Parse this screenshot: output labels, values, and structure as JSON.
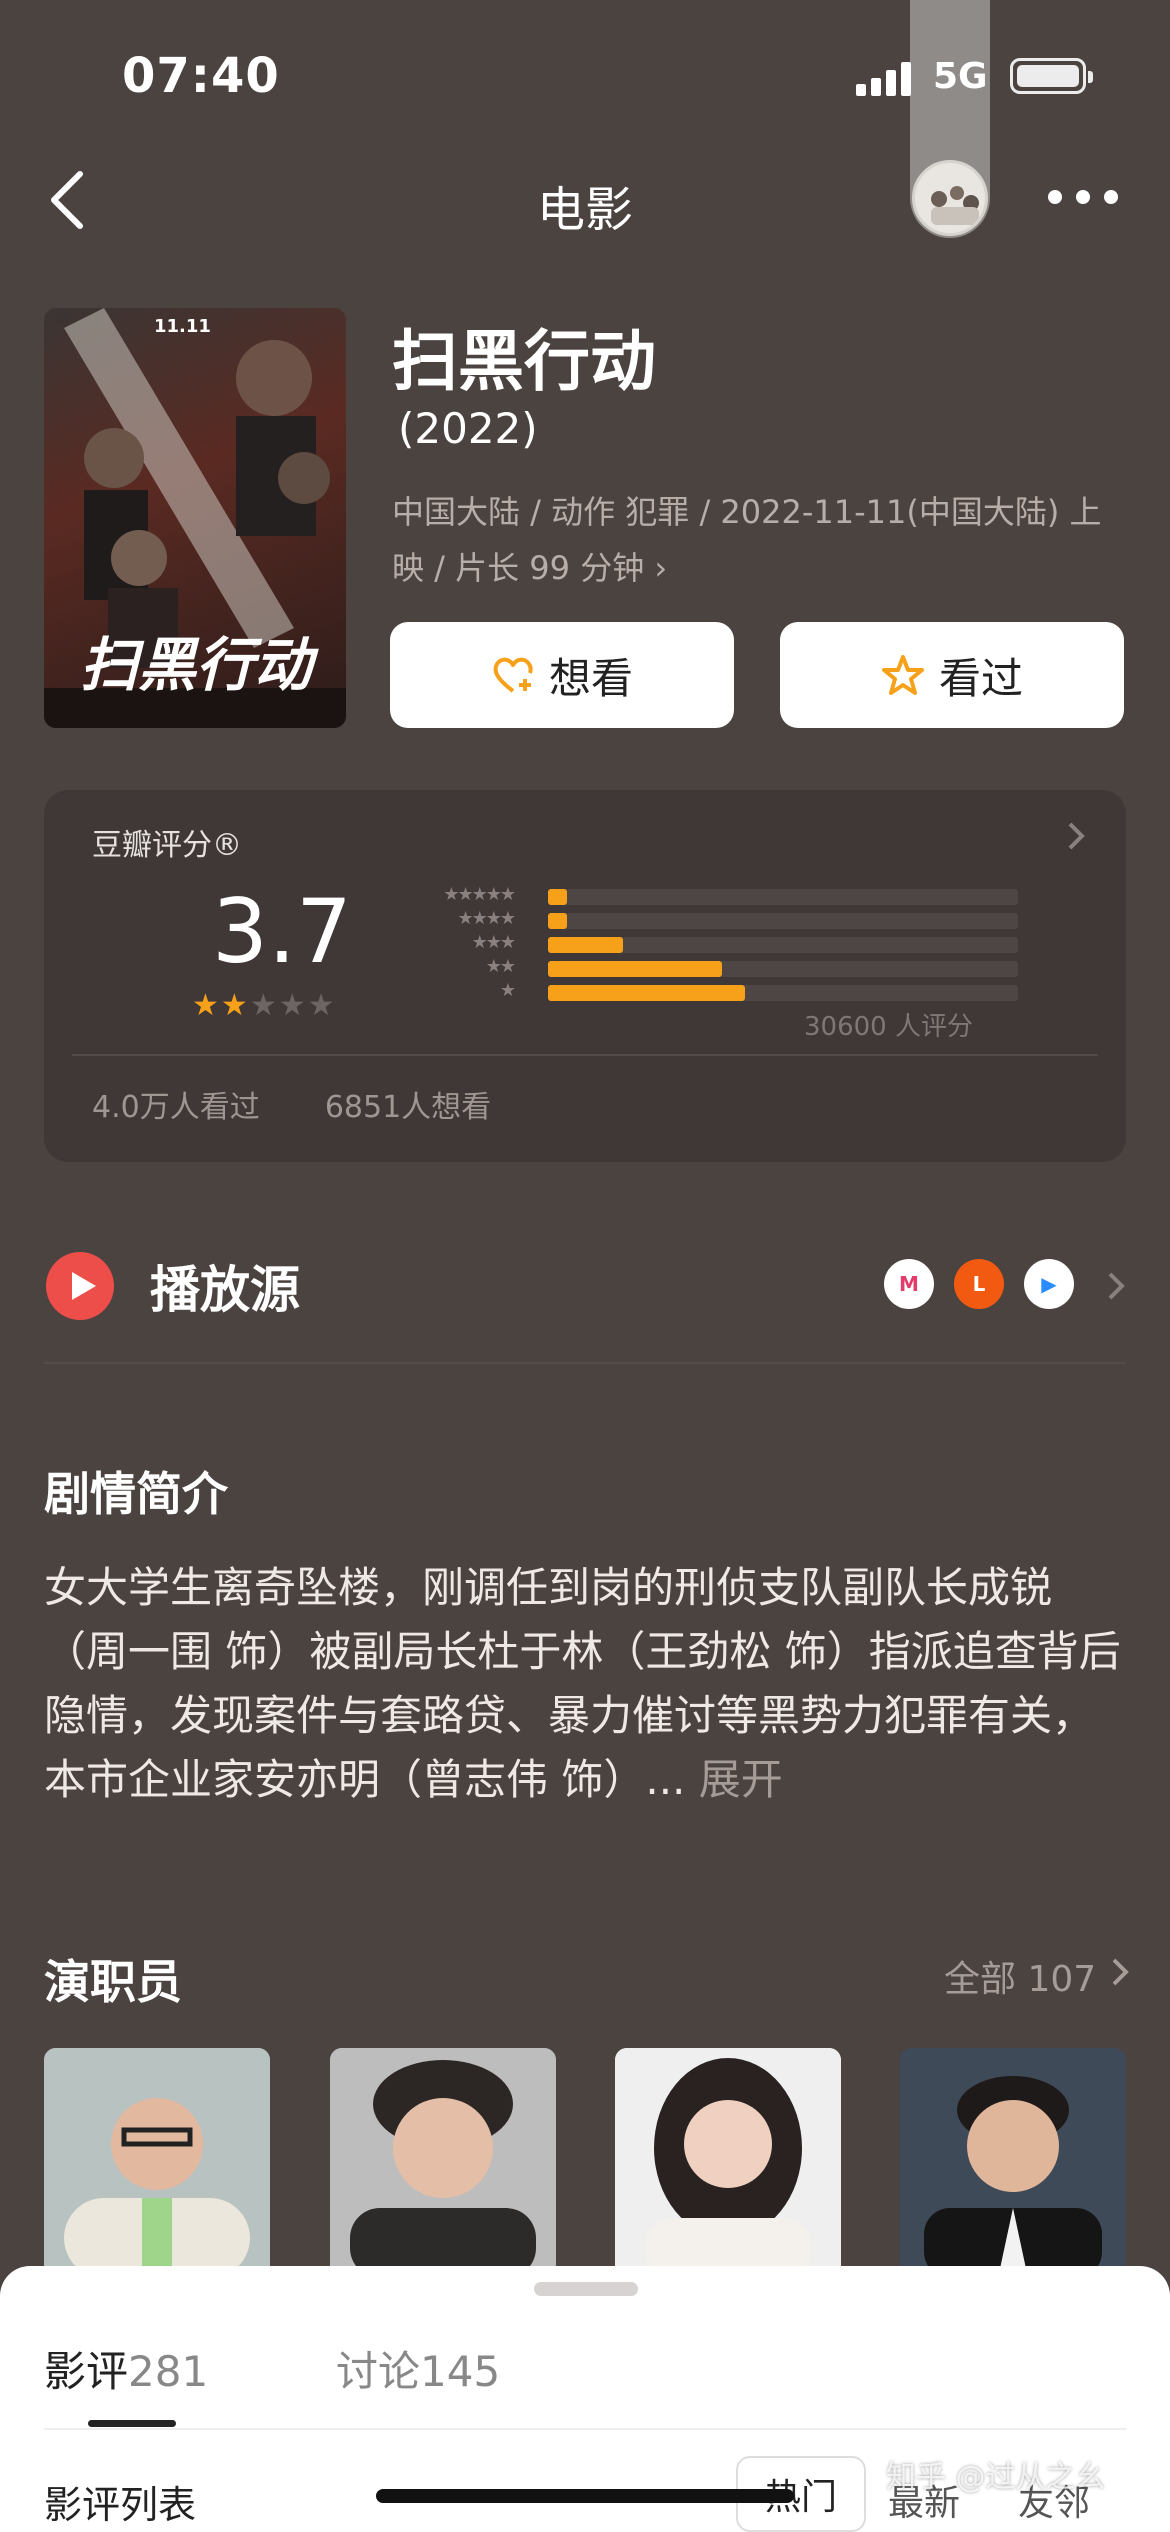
{
  "status_bar": {
    "time": "07:40",
    "network": "5G"
  },
  "nav": {
    "title": "电影"
  },
  "movie": {
    "title": "扫黑行动",
    "year": "(2022)",
    "meta": "中国大陆 / 动作 犯罪 / 2022-11-11(中国大陆) 上映 / 片长 99 分钟 ›",
    "want_label": "想看",
    "seen_label": "看过",
    "poster_text": "扫黑行动",
    "poster_date": "11.11"
  },
  "rating": {
    "label": "豆瓣评分®",
    "score": "3.7",
    "star_level": 2,
    "distribution": [
      {
        "stars": "★★★★★",
        "pct": 4
      },
      {
        "stars": "★★★★",
        "pct": 4
      },
      {
        "stars": "★★★",
        "pct": 16
      },
      {
        "stars": "★★",
        "pct": 37
      },
      {
        "stars": "★",
        "pct": 42
      }
    ],
    "count": "30600 人评分",
    "watched": "4.0万人看过",
    "want": "6851人想看"
  },
  "sources": {
    "label": "播放源",
    "logos": [
      {
        "name": "mgtv",
        "text": "M",
        "color": "#ffffff"
      },
      {
        "name": "letv",
        "text": "L",
        "color": "#f25a12"
      },
      {
        "name": "youku",
        "text": "▶",
        "color": "#ffffff"
      }
    ]
  },
  "synopsis": {
    "title": "剧情简介",
    "text": "女大学生离奇坠楼，刚调任到岗的刑侦支队副队长成锐（周一围 饰）被副局长杜于林（王劲松 饰）指派追查背后隐情，发现案件与套路贷、暴力催讨等黑势力犯罪有关，本市企业家安亦明（曾志伟 饰）...",
    "expand": " 展开"
  },
  "cast": {
    "title": "演职员",
    "all": "全部 107"
  },
  "sheet": {
    "tabs": [
      {
        "label": "影评",
        "count": "281"
      },
      {
        "label": "讨论",
        "count": "145"
      }
    ],
    "list_label": "影评列表",
    "sorts": [
      "热门",
      "最新",
      "友邻"
    ]
  },
  "watermark": "知乎 @过从之幺",
  "colors": {
    "background": "#4b4340",
    "accent": "#f7a11b",
    "play": "#ee4e49"
  }
}
